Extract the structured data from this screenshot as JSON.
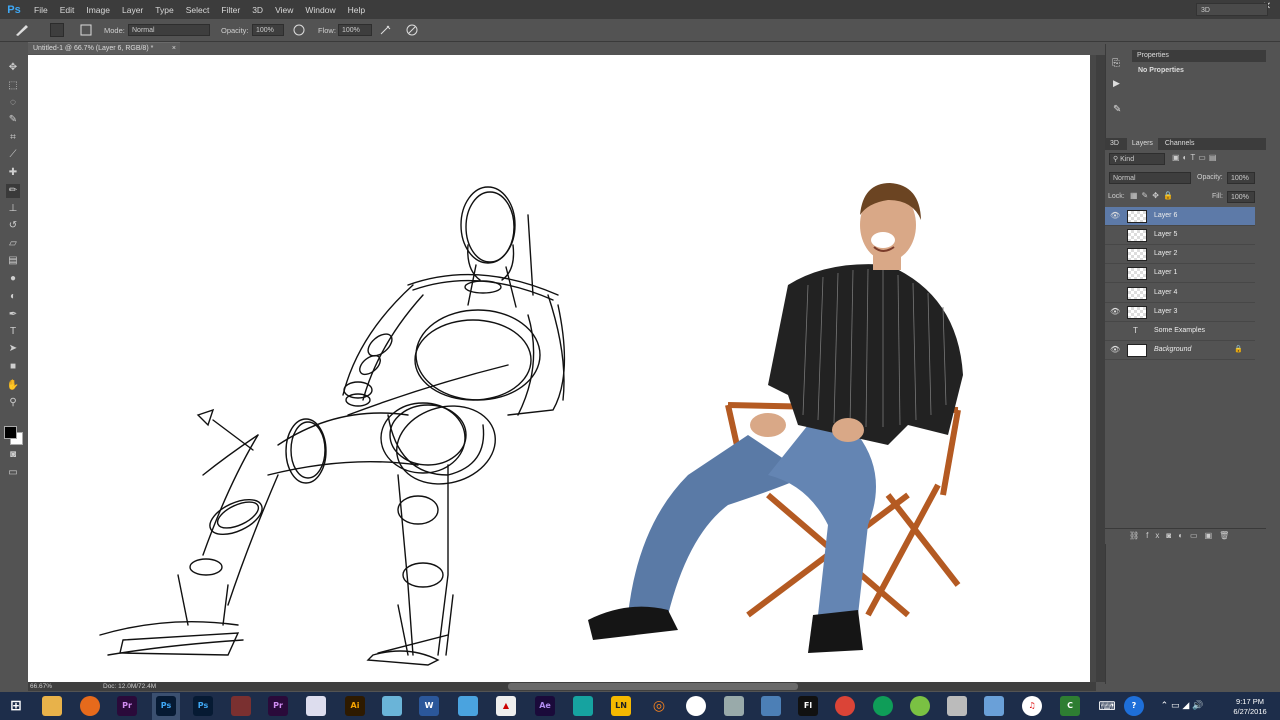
{
  "app": {
    "logo": "Ps",
    "workspace": "3D"
  },
  "menu": [
    "File",
    "Edit",
    "Image",
    "Layer",
    "Type",
    "Select",
    "Filter",
    "3D",
    "View",
    "Window",
    "Help"
  ],
  "window_controls": {
    "minimize": "–",
    "restore": "▭",
    "close": "✕"
  },
  "options_bar": {
    "mode_label": "Mode:",
    "mode_value": "Normal",
    "opacity_label": "Opacity:",
    "opacity_value": "100%",
    "flow_label": "Flow:",
    "flow_value": "100%"
  },
  "document": {
    "tab_title": "Untitled-1 @ 66.7% (Layer 6, RGB/8) *",
    "close": "×"
  },
  "status": {
    "zoom": "66.67%",
    "doc": "Doc: 12.0M/72.4M"
  },
  "properties": {
    "tab": "Properties",
    "content": "No Properties"
  },
  "layers_panel": {
    "tabs": [
      "3D",
      "Layers",
      "Channels"
    ],
    "filter_label": "Kind",
    "blend_mode": "Normal",
    "opacity_label": "Opacity:",
    "opacity_value": "100%",
    "lock_label": "Lock:",
    "fill_label": "Fill:",
    "fill_value": "100%",
    "layers": [
      {
        "name": "Layer 6",
        "visible": true,
        "selected": true
      },
      {
        "name": "Layer 5",
        "visible": false,
        "selected": false
      },
      {
        "name": "Layer 2",
        "visible": false,
        "selected": false
      },
      {
        "name": "Layer 1",
        "visible": false,
        "selected": false
      },
      {
        "name": "Layer 4",
        "visible": false,
        "selected": false
      },
      {
        "name": "Layer 3",
        "visible": true,
        "selected": false
      },
      {
        "name": "Some Examples",
        "visible": false,
        "selected": false,
        "type": "text"
      },
      {
        "name": "Background",
        "visible": true,
        "selected": false,
        "locked": true
      }
    ]
  },
  "taskbar": {
    "apps": [
      "Pr",
      "Ps",
      "Ps",
      "Ai",
      "W",
      "Ae",
      "LN",
      "Fl"
    ],
    "clock_time": "9:17 PM",
    "clock_date": "6/27/2016"
  },
  "colors": {
    "accent_selected_layer": "#5d7aa8",
    "taskbar": "#1d2d4a",
    "ps_blue": "#3fa8f5"
  }
}
